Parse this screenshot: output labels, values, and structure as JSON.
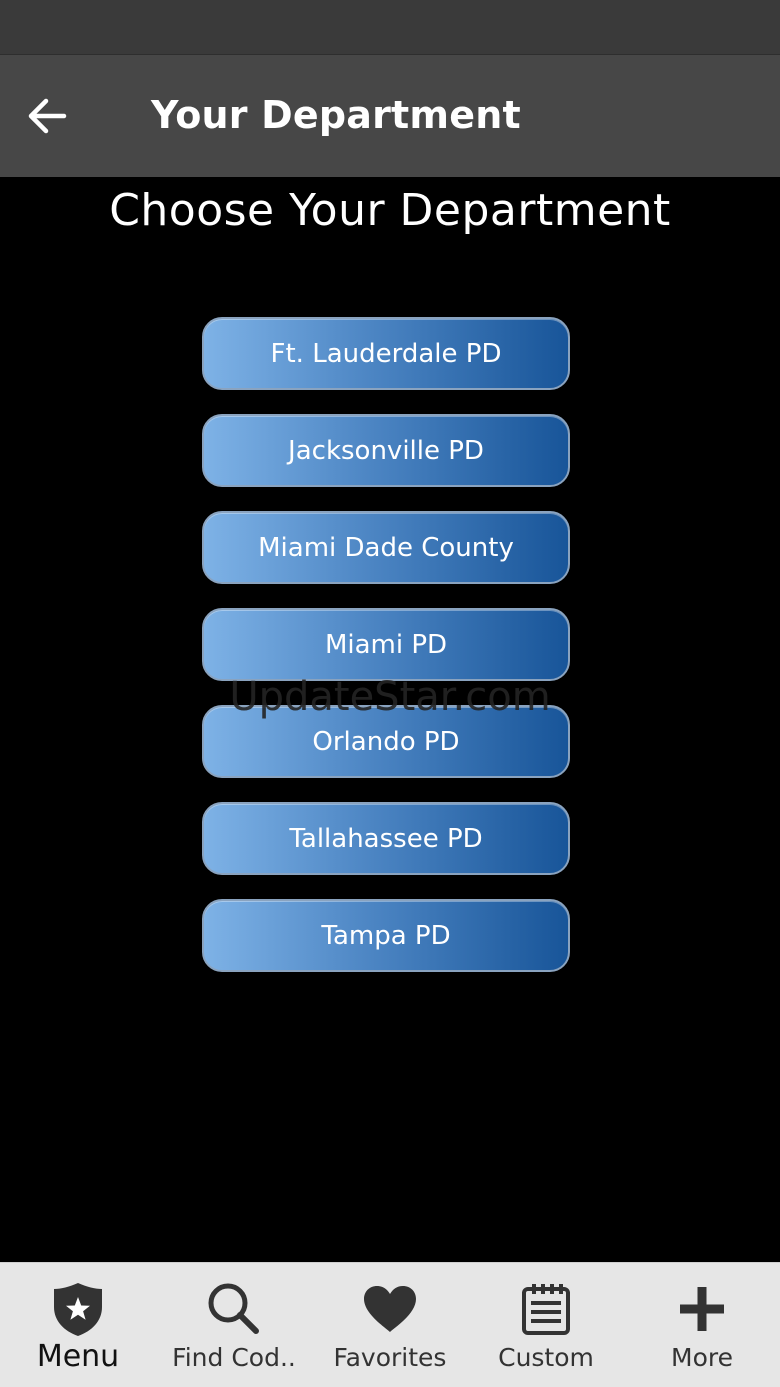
{
  "app_bar": {
    "title": "Your Department",
    "back_icon": "arrow-left-icon"
  },
  "main": {
    "heading": "Choose Your Department",
    "departments": [
      {
        "label": "Ft. Lauderdale PD"
      },
      {
        "label": "Jacksonville PD"
      },
      {
        "label": "Miami Dade County"
      },
      {
        "label": "Miami PD"
      },
      {
        "label": "Orlando PD"
      },
      {
        "label": "Tallahassee PD"
      },
      {
        "label": "Tampa PD"
      }
    ]
  },
  "watermark": "UpdateStar.com",
  "tab_bar": {
    "tabs": [
      {
        "label": "Menu",
        "icon": "badge-star-icon",
        "active": true
      },
      {
        "label": "Find Cod..",
        "icon": "search-icon",
        "active": false
      },
      {
        "label": "Favorites",
        "icon": "heart-icon",
        "active": false
      },
      {
        "label": "Custom",
        "icon": "notepad-icon",
        "active": false
      },
      {
        "label": "More",
        "icon": "plus-icon",
        "active": false
      }
    ]
  },
  "colors": {
    "status_bar": "#3a3a3a",
    "app_bar": "#474747",
    "background": "#000000",
    "button_gradient_start": "#7eb2e6",
    "button_gradient_end": "#185599",
    "tab_bar": "#e6e6e6",
    "tab_icon": "#333333"
  }
}
